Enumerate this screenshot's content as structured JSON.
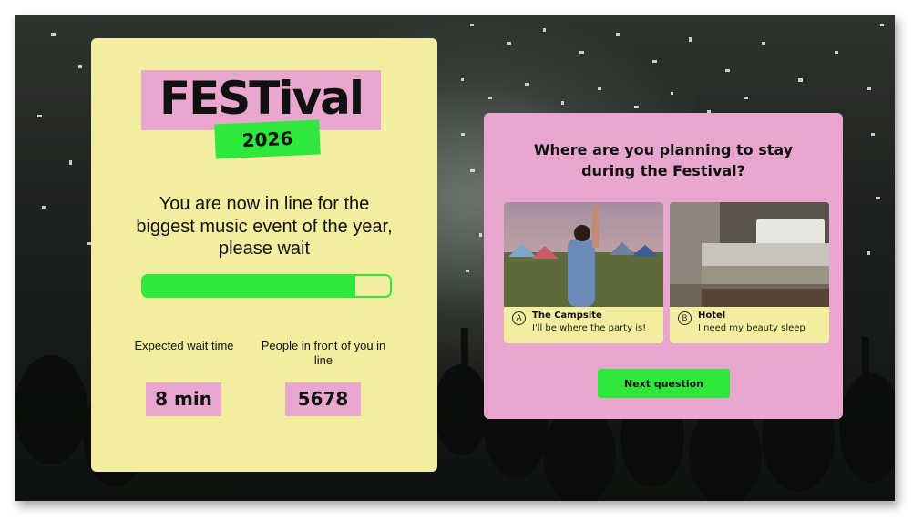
{
  "logo": {
    "title": "FESTival",
    "year": "2026"
  },
  "queue": {
    "message": "You are now in line for the biggest music event of the year, please wait",
    "progress_fraction": 0.86,
    "wait_label": "Expected wait time",
    "wait_value": "8 min",
    "people_label": "People in front of you in line",
    "people_value": "5678"
  },
  "question": {
    "title": "Where are you planning to stay during the Festival?",
    "options": [
      {
        "letter": "A",
        "title": "The Campsite",
        "subtitle": "I'll be where the party is!",
        "image": "campsite-photo"
      },
      {
        "letter": "B",
        "title": "Hotel",
        "subtitle": "I need my beauty sleep",
        "image": "hotel-room-photo"
      }
    ],
    "next_label": "Next question"
  },
  "colors": {
    "yellow": "#f3ee9f",
    "pink": "#e9a7cf",
    "green": "#2ee83c"
  }
}
